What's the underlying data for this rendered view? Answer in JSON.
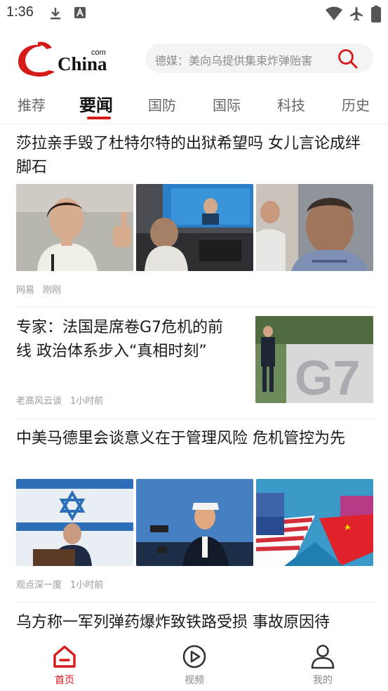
{
  "status_bar": {
    "time": "1:36"
  },
  "header": {
    "logo_text": "China",
    "logo_small": "com",
    "search_placeholder": "德媒：美向乌提供集束炸弹贻害"
  },
  "tabs": [
    {
      "label": "推荐",
      "active": false
    },
    {
      "label": "要闻",
      "active": true
    },
    {
      "label": "国防",
      "active": false
    },
    {
      "label": "国际",
      "active": false
    },
    {
      "label": "科技",
      "active": false
    },
    {
      "label": "历史",
      "active": false
    }
  ],
  "articles": [
    {
      "title": "莎拉亲手毁了杜特尔特的出狱希望吗 女儿言论成绊脚石",
      "source": "网易",
      "time": "刚刚"
    },
    {
      "title": "专家：法国是席卷G7危机的前线 政治体系步入“真相时刻”",
      "source": "老高风云谈",
      "time": "1小时前",
      "thumb_text": "G7"
    },
    {
      "title": "中美马德里会谈意义在于管理风险 危机管控为先",
      "source": "观点深一度",
      "time": "1小时前"
    },
    {
      "title": "乌方称一军列弹药爆炸致铁路受损 事故原因待"
    }
  ],
  "bottom_nav": [
    {
      "label": "首页",
      "active": true
    },
    {
      "label": "视频",
      "active": false
    },
    {
      "label": "我的",
      "active": false
    }
  ],
  "colors": {
    "accent": "#d61a1a",
    "text": "#1a1a1a",
    "meta": "#999999"
  }
}
